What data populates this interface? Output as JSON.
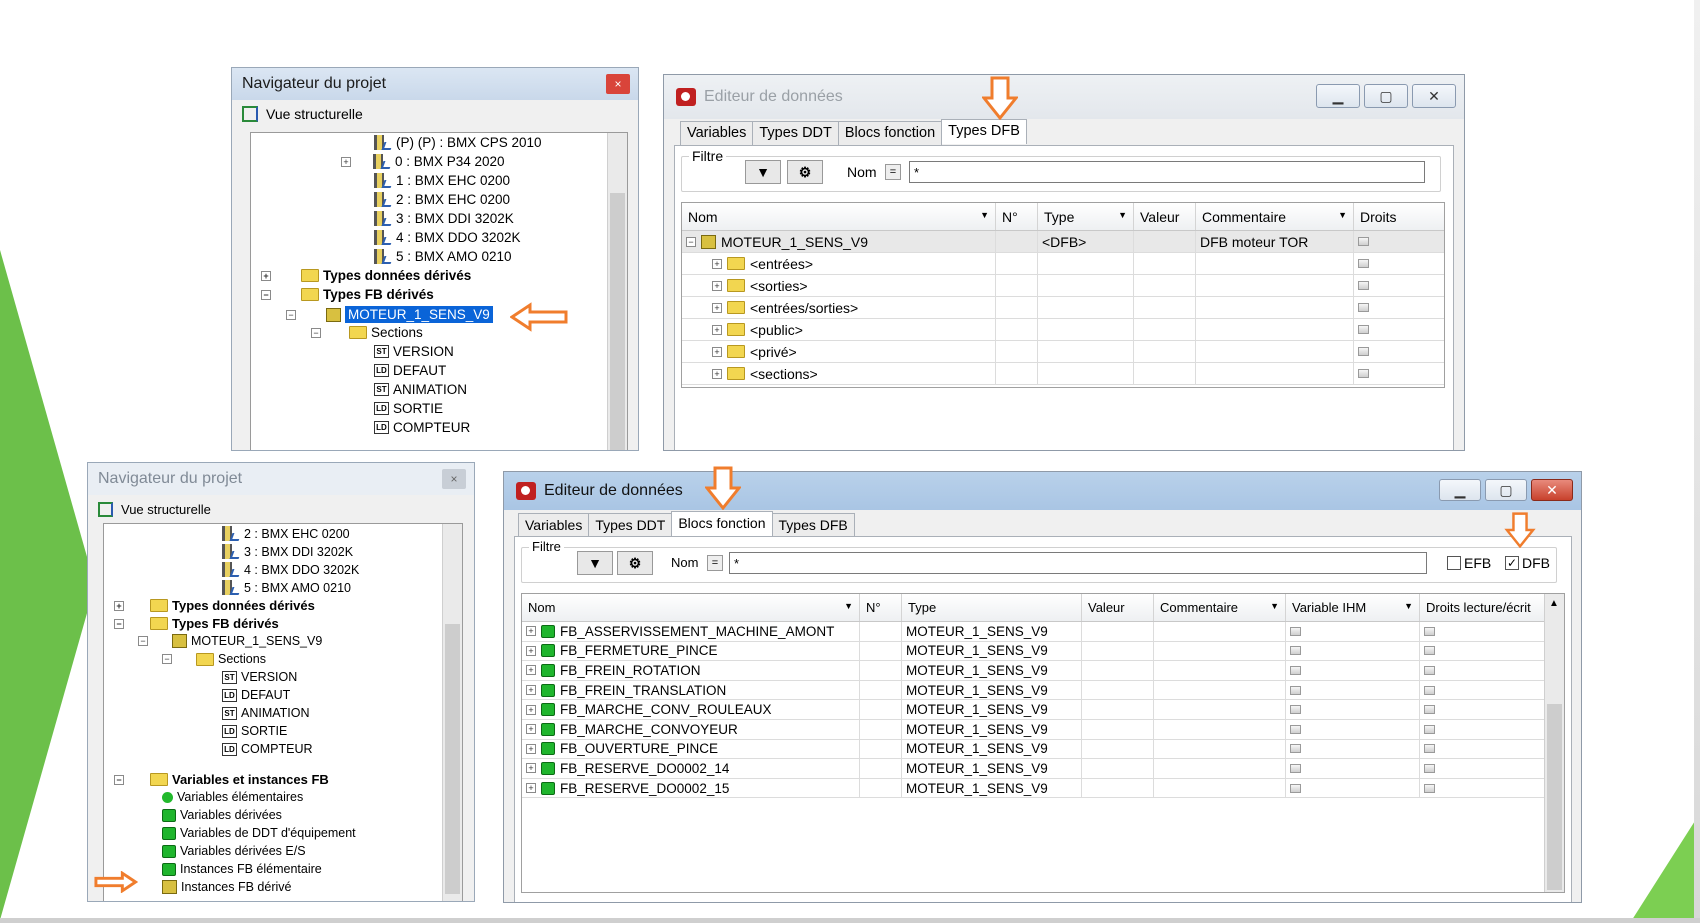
{
  "colors": {
    "accent_arrow": "#f07d2d",
    "selection": "#0a64d8",
    "green": "#6cc04a"
  },
  "nav1": {
    "title": "Navigateur du projet",
    "close": "×",
    "view_label": "Vue structurelle",
    "rows": [
      {
        "label": "(P) (P) : BMX CPS 2010"
      },
      {
        "label": "0 : BMX P34 2020"
      },
      {
        "label": "1 : BMX EHC 0200"
      },
      {
        "label": "2 : BMX EHC 0200"
      },
      {
        "label": "3 : BMX DDI 3202K"
      },
      {
        "label": "4 : BMX DDO 3202K"
      },
      {
        "label": "5 : BMX AMO 0210"
      },
      {
        "label": "Types données dérivés"
      },
      {
        "label": "Types FB dérivés"
      },
      {
        "label": "MOTEUR_1_SENS_V9"
      },
      {
        "label": "Sections"
      },
      {
        "label": "VERSION",
        "code": "ST"
      },
      {
        "label": "DEFAUT",
        "code": "LD"
      },
      {
        "label": "ANIMATION",
        "code": "ST"
      },
      {
        "label": "SORTIE",
        "code": "LD"
      },
      {
        "label": "COMPTEUR",
        "code": "LD"
      }
    ]
  },
  "editor1": {
    "title": "Editeur de données",
    "tabs": [
      "Variables",
      "Types DDT",
      "Blocs fonction",
      "Types DFB"
    ],
    "filter_label": "Filtre",
    "name_label": "Nom",
    "eq": "=",
    "filter_value": "*",
    "columns": [
      "Nom",
      "N°",
      "Type",
      "Valeur",
      "Commentaire",
      "Droits"
    ],
    "rows": [
      {
        "name": "MOTEUR_1_SENS_V9",
        "type": "<DFB>",
        "comment": "DFB moteur TOR"
      },
      {
        "name": "<entrées>"
      },
      {
        "name": "<sorties>"
      },
      {
        "name": "<entrées/sorties>"
      },
      {
        "name": "<public>"
      },
      {
        "name": "<privé>"
      },
      {
        "name": "<sections>"
      }
    ]
  },
  "nav2": {
    "title": "Navigateur du projet",
    "close": "×",
    "view_label": "Vue structurelle",
    "rows": [
      {
        "label": "2 : BMX EHC 0200"
      },
      {
        "label": "3 : BMX DDI 3202K"
      },
      {
        "label": "4 : BMX DDO 3202K"
      },
      {
        "label": "5 : BMX AMO 0210"
      },
      {
        "label": "Types données dérivés"
      },
      {
        "label": "Types FB dérivés"
      },
      {
        "label": "MOTEUR_1_SENS_V9"
      },
      {
        "label": "Sections"
      },
      {
        "label": "VERSION",
        "code": "ST"
      },
      {
        "label": "DEFAUT",
        "code": "LD"
      },
      {
        "label": "ANIMATION",
        "code": "ST"
      },
      {
        "label": "SORTIE",
        "code": "LD"
      },
      {
        "label": "COMPTEUR",
        "code": "LD"
      },
      {
        "label": "Variables et instances FB"
      },
      {
        "label": "Variables élémentaires"
      },
      {
        "label": "Variables dérivées"
      },
      {
        "label": "Variables de DDT d'équipement"
      },
      {
        "label": "Variables dérivées E/S"
      },
      {
        "label": "Instances FB élémentaire"
      },
      {
        "label": "Instances FB dérivé"
      }
    ]
  },
  "editor2": {
    "title": "Editeur de données",
    "tabs": [
      "Variables",
      "Types DDT",
      "Blocs fonction",
      "Types DFB"
    ],
    "filter_label": "Filtre",
    "name_label": "Nom",
    "eq": "=",
    "filter_value": "*",
    "efb": "EFB",
    "dfb": "DFB",
    "check": "✓",
    "columns": [
      "Nom",
      "N°",
      "Type",
      "Valeur",
      "Commentaire",
      "Variable IHM",
      "Droits lecture/écrit"
    ],
    "rows": [
      {
        "name": "FB_ASSERVISSEMENT_MACHINE_AMONT",
        "type": "MOTEUR_1_SENS_V9"
      },
      {
        "name": "FB_FERMETURE_PINCE",
        "type": "MOTEUR_1_SENS_V9"
      },
      {
        "name": "FB_FREIN_ROTATION",
        "type": "MOTEUR_1_SENS_V9"
      },
      {
        "name": "FB_FREIN_TRANSLATION",
        "type": "MOTEUR_1_SENS_V9"
      },
      {
        "name": "FB_MARCHE_CONV_ROULEAUX",
        "type": "MOTEUR_1_SENS_V9"
      },
      {
        "name": "FB_MARCHE_CONVOYEUR",
        "type": "MOTEUR_1_SENS_V9"
      },
      {
        "name": "FB_OUVERTURE_PINCE",
        "type": "MOTEUR_1_SENS_V9"
      },
      {
        "name": "FB_RESERVE_DO0002_14",
        "type": "MOTEUR_1_SENS_V9"
      },
      {
        "name": "FB_RESERVE_DO0002_15",
        "type": "MOTEUR_1_SENS_V9"
      }
    ]
  }
}
